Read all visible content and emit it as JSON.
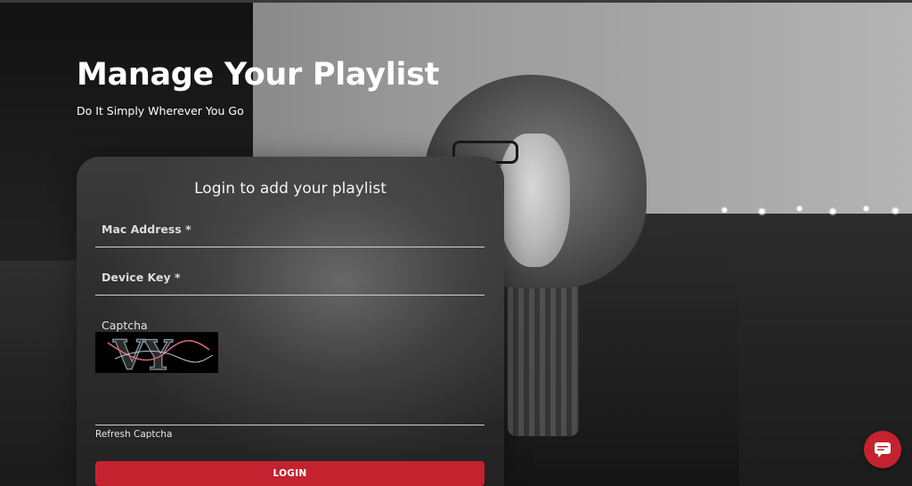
{
  "hero": {
    "title": "Manage Your Playlist",
    "subtitle": "Do It Simply Wherever You Go"
  },
  "login_form": {
    "title": "Login to add your playlist",
    "mac_address_label": "Mac Address *",
    "device_key_label": "Device Key *",
    "captcha_label": "Captcha",
    "captcha_text": "VY",
    "refresh_captcha": "Refresh Captcha",
    "login_button": "LOGIN"
  },
  "colors": {
    "accent": "#c4222f"
  },
  "chat_widget": {
    "icon": "chat-bubble-icon"
  }
}
